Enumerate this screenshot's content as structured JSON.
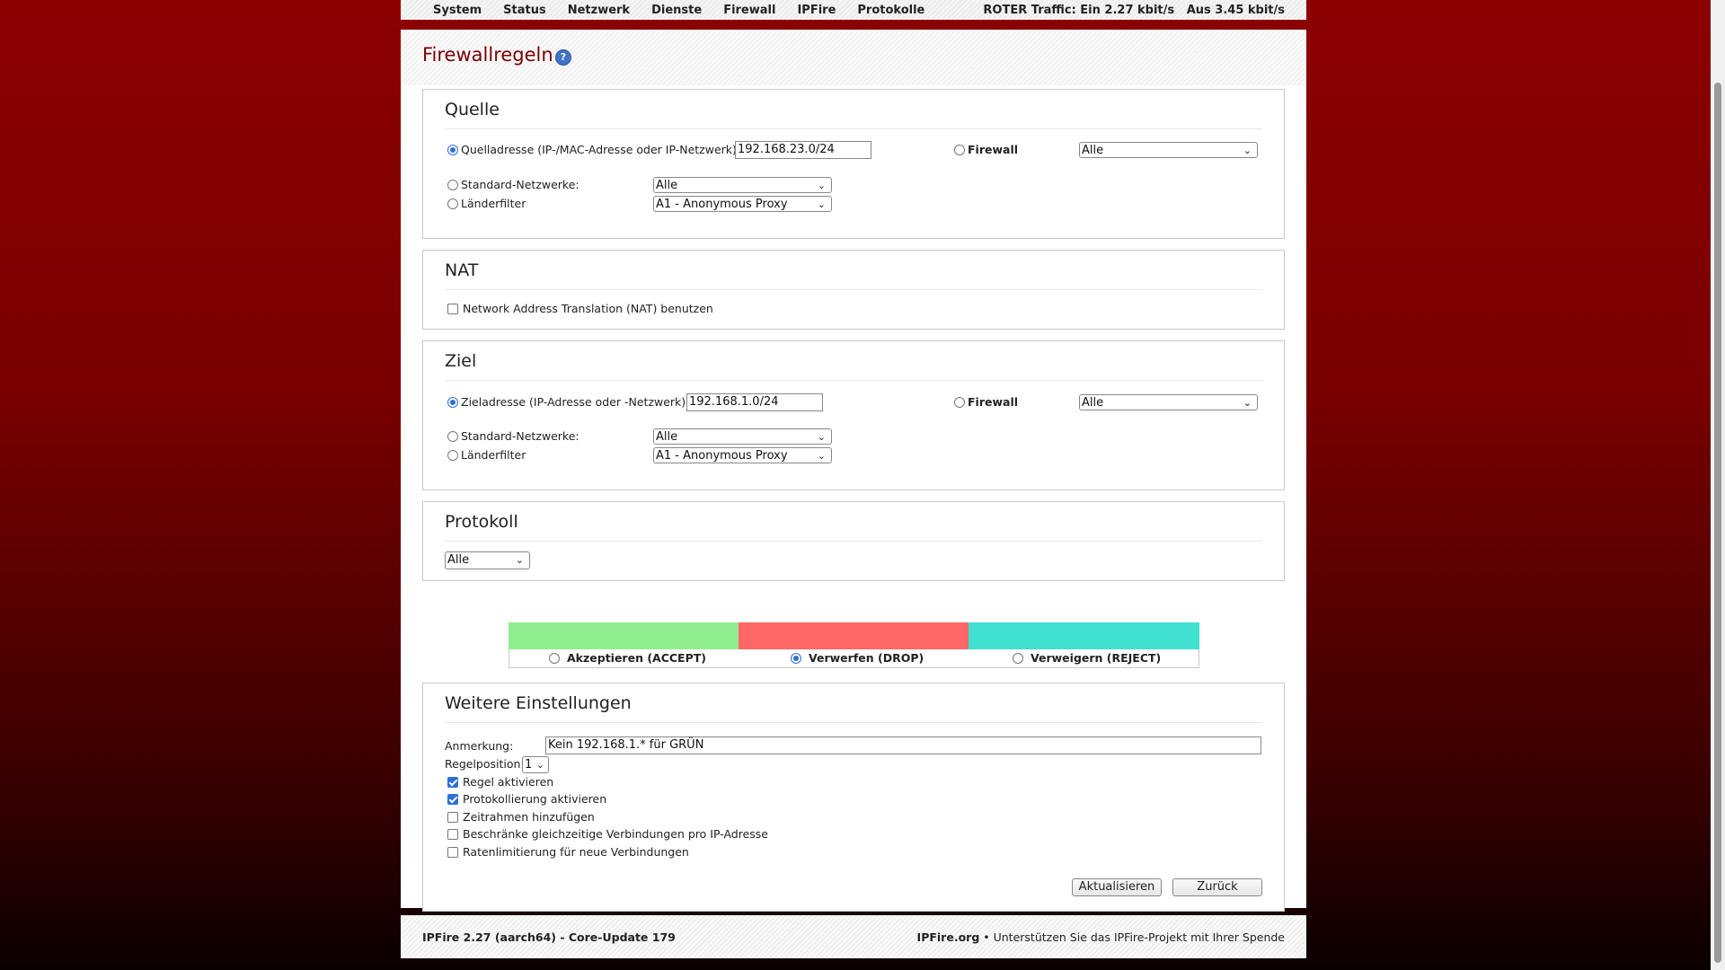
{
  "nav": {
    "items": [
      "System",
      "Status",
      "Netzwerk",
      "Dienste",
      "Firewall",
      "IPFire",
      "Protokolle"
    ],
    "traffic": "ROTER Traffic: Ein 2.27 kbit/s   Aus 3.45 kbit/s"
  },
  "page": {
    "title": "Firewallregeln",
    "help_icon": "?"
  },
  "quelle": {
    "title": "Quelle",
    "source_address_label": "Quelladresse (IP-/MAC-Adresse oder IP-Netzwerk):",
    "source_address_value": "192.168.23.0/24",
    "firewall_label": "Firewall",
    "firewall_select": "Alle",
    "standard_networks_label": "Standard-Netzwerke:",
    "standard_networks_select": "Alle",
    "country_filter_label": "Länderfilter",
    "country_filter_select": "A1 - Anonymous Proxy"
  },
  "nat": {
    "title": "NAT",
    "checkbox_label": "Network Address Translation (NAT) benutzen"
  },
  "ziel": {
    "title": "Ziel",
    "dest_address_label": "Zieladresse (IP-Adresse oder -Netzwerk):",
    "dest_address_value": "192.168.1.0/24",
    "firewall_label": "Firewall",
    "firewall_select": "Alle",
    "standard_networks_label": "Standard-Netzwerke:",
    "standard_networks_select": "Alle",
    "country_filter_label": "Länderfilter",
    "country_filter_select": "A1 - Anonymous Proxy"
  },
  "protokoll": {
    "title": "Protokoll",
    "select": "Alle"
  },
  "actions": {
    "accept": "Akzeptieren (ACCEPT)",
    "drop": "Verwerfen (DROP)",
    "reject": "Verweigern (REJECT)",
    "selected": "drop",
    "colors": {
      "accept": "#90ee90",
      "drop": "#ff6666",
      "reject": "#40e0d0"
    }
  },
  "weitere": {
    "title": "Weitere Einstellungen",
    "remark_label": "Anmerkung:",
    "remark_value": "Kein 192.168.1.* für GRÜN",
    "position_label": "Regelposition:",
    "position_value": "1",
    "enable_rule": "Regel aktivieren",
    "enable_logging": "Protokollierung aktivieren",
    "add_timeframe": "Zeitrahmen hinzufügen",
    "limit_concurrent": "Beschränke gleichzeitige Verbindungen pro IP-Adresse",
    "rate_limit": "Ratenlimitierung für neue Verbindungen",
    "update_button": "Aktualisieren",
    "back_button": "Zurück"
  },
  "footer": {
    "version": "IPFire 2.27 (aarch64) - Core-Update 179",
    "site": "IPFire.org",
    "donate": " • Unterstützen Sie das IPFire-Projekt mit Ihrer Spende"
  }
}
